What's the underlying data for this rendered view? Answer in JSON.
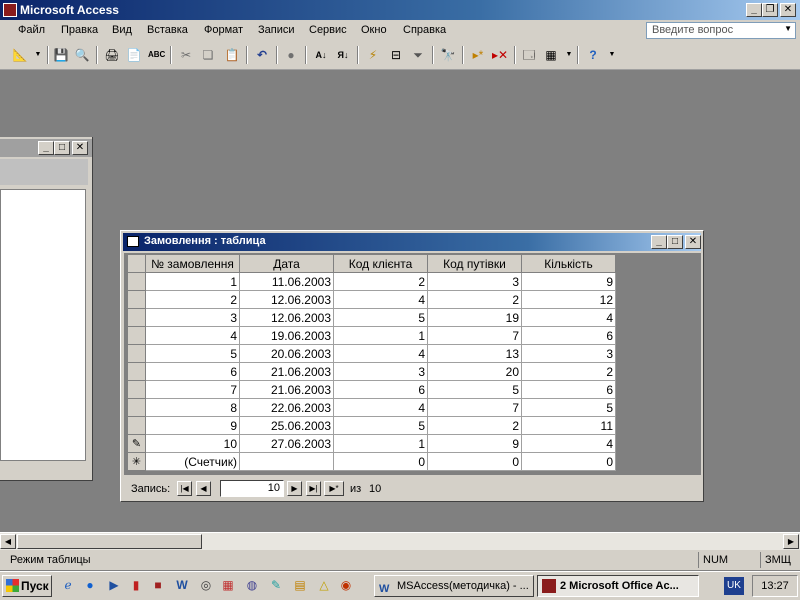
{
  "app": {
    "title": "Microsoft Access"
  },
  "menu": {
    "items": [
      "Файл",
      "Правка",
      "Вид",
      "Вставка",
      "Формат",
      "Записи",
      "Сервис",
      "Окно",
      "Справка"
    ],
    "question_placeholder": "Введите вопрос"
  },
  "datasheet": {
    "title": "Замовлення : таблица",
    "columns": [
      "№ замовлення",
      "Дата",
      "Код клієнта",
      "Код путівки",
      "Кількість"
    ],
    "rows": [
      [
        "1",
        "11.06.2003",
        "2",
        "3",
        "9"
      ],
      [
        "2",
        "12.06.2003",
        "4",
        "2",
        "12"
      ],
      [
        "3",
        "12.06.2003",
        "5",
        "19",
        "4"
      ],
      [
        "4",
        "19.06.2003",
        "1",
        "7",
        "6"
      ],
      [
        "5",
        "20.06.2003",
        "4",
        "13",
        "3"
      ],
      [
        "6",
        "21.06.2003",
        "3",
        "20",
        "2"
      ],
      [
        "7",
        "21.06.2003",
        "6",
        "5",
        "6"
      ],
      [
        "8",
        "22.06.2003",
        "4",
        "7",
        "5"
      ],
      [
        "9",
        "25.06.2003",
        "5",
        "2",
        "11"
      ],
      [
        "10",
        "27.06.2003",
        "1",
        "9",
        "4"
      ]
    ],
    "new_row": [
      "(Счетчик)",
      "",
      "0",
      "0",
      "0"
    ],
    "nav": {
      "label": "Запись:",
      "current": "10",
      "of_label": "из",
      "total": "10"
    }
  },
  "status": {
    "mode": "Режим таблицы",
    "num": "NUM",
    "lang_mode": "ЗМЩ"
  },
  "taskbar": {
    "start": "Пуск",
    "tasks": [
      "MSAccess(методичка) - ...",
      "2 Microsoft Office Ac..."
    ],
    "lang": "UK",
    "clock": "13:27"
  }
}
